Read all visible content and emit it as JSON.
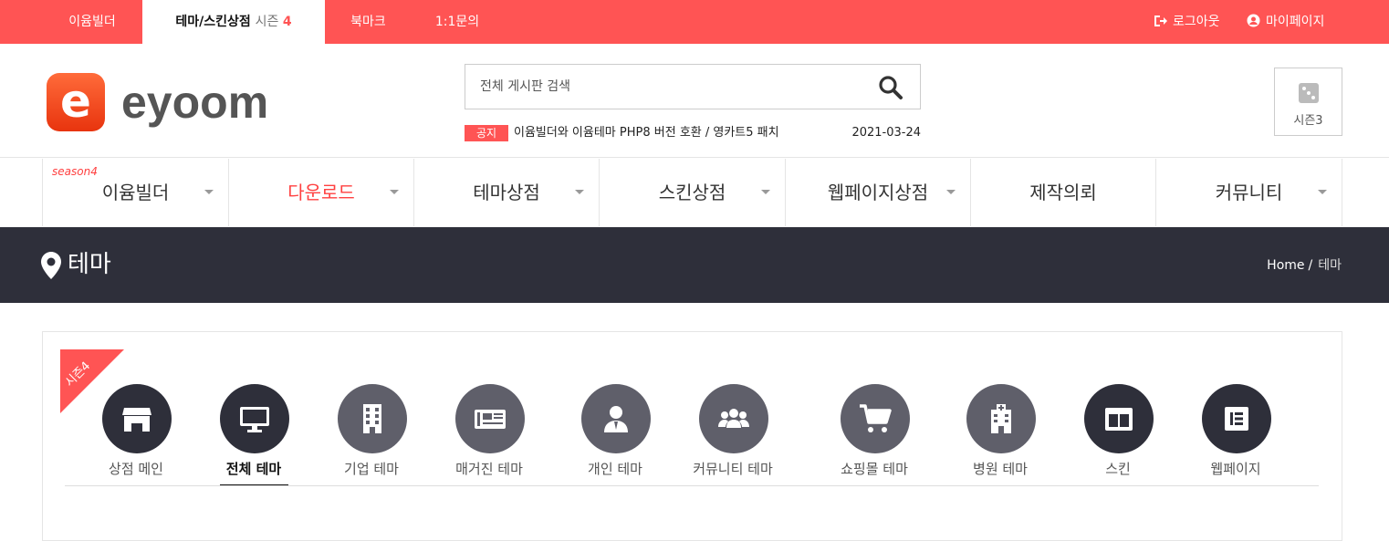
{
  "topbar": {
    "links": [
      "이윰빌더",
      "테마/스킨상점",
      "북마크",
      "1:1문의"
    ],
    "season_prefix": "시즌",
    "season_num": "4",
    "logout": "로그아웃",
    "mypage": "마이페이지"
  },
  "header": {
    "logo_text": "eyoom",
    "logo_mark": "e",
    "search_placeholder": "전체 게시판 검색",
    "notice_tag": "공지",
    "notice_text": "이윰빌더와 이윰테마 PHP8 버전 호환 / 영카트5 패치",
    "notice_date": "2021-03-24",
    "season_box": "시즌3"
  },
  "nav": {
    "season_tag": "season4",
    "items": [
      "이윰빌더",
      "다운로드",
      "테마상점",
      "스킨상점",
      "웹페이지상점",
      "제작의뢰",
      "커뮤니티"
    ]
  },
  "banner": {
    "title": "테마",
    "crumb_home": "Home",
    "crumb_sep": "/",
    "crumb_current": "테마"
  },
  "panel": {
    "ribbon": "시즌4",
    "categories": [
      {
        "label": "상점 메인",
        "icon": "store-icon"
      },
      {
        "label": "전체 테마",
        "icon": "monitor-icon"
      },
      {
        "label": "기업 테마",
        "icon": "building-icon"
      },
      {
        "label": "매거진 테마",
        "icon": "newspaper-icon"
      },
      {
        "label": "개인 테마",
        "icon": "user-icon"
      },
      {
        "label": "커뮤니티 테마",
        "icon": "users-icon"
      },
      {
        "label": "쇼핑몰 테마",
        "icon": "cart-icon"
      },
      {
        "label": "병원 테마",
        "icon": "hospital-icon"
      },
      {
        "label": "스킨",
        "icon": "columns-icon"
      },
      {
        "label": "웹페이지",
        "icon": "page-icon"
      }
    ],
    "active_index": 1
  },
  "colors": {
    "accent": "#ff5454",
    "dark": "#2e2f3a",
    "circle": "#5f5f6a"
  }
}
